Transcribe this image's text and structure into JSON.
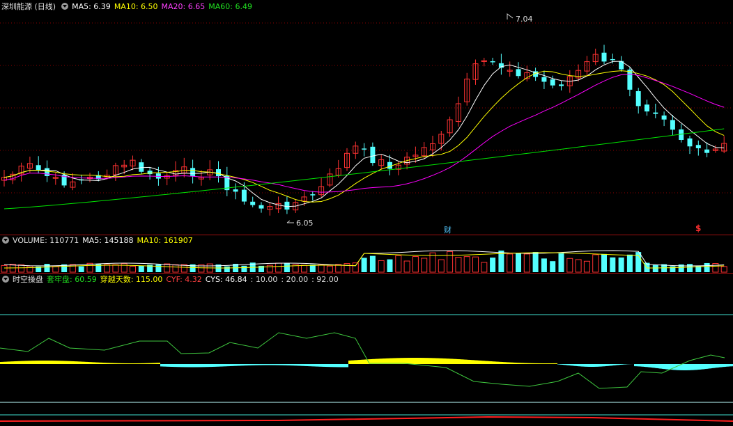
{
  "header": {
    "title": "深圳能源 (日线)",
    "ma5": "MA5: 6.39",
    "ma10": "MA10: 6.50",
    "ma20": "MA20: 6.65",
    "ma60": "MA60: 6.49"
  },
  "volume_header": {
    "label": "VOLUME: 110771",
    "ma5": "MA5: 145188",
    "ma10": "MA10: 161907"
  },
  "indicator_header": {
    "name": "时空操盘",
    "tlp": "套牢盘: 60.59",
    "cyts": "穿越天数: 115.00",
    "cyf": "CYF: 4.32",
    "cys": "CYS: 46.84",
    "p1": ": 10.00",
    "p2": ": 20.00",
    "p3": ": 92.00"
  },
  "annotations": {
    "high": "7.04",
    "low": "6.05",
    "fin_marker": "财",
    "div_marker": "$"
  },
  "colors": {
    "up": "#ff3232",
    "down": "#54ffff",
    "ma5": "#ffffff",
    "ma10": "#ffff00",
    "ma20": "#ff00ff",
    "ma60": "#00e600",
    "grid": "#8b0000",
    "cyan_line": "#40e0d0",
    "tlp_line": "#3fc83f"
  }
}
